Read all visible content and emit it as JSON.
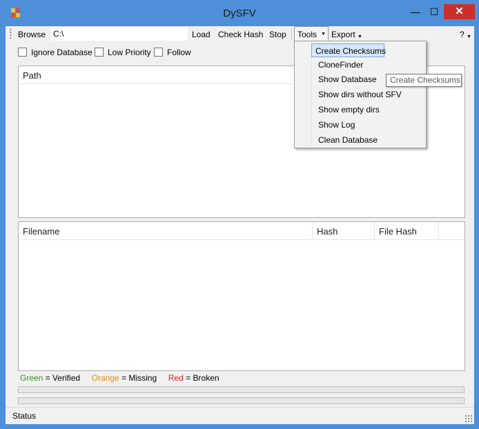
{
  "window": {
    "title": "DySFV",
    "minimize": "—",
    "maximize": "☐",
    "close": "✕"
  },
  "toolbar": {
    "browse": "Browse",
    "path_value": "C:\\",
    "load": "Load",
    "check_hash": "Check Hash",
    "stop": "Stop",
    "tools": "Tools",
    "export": "Export",
    "help": "?"
  },
  "options": {
    "ignore_database": "Ignore Database",
    "low_priority": "Low Priority",
    "follow": "Follow"
  },
  "path_list": {
    "columns": [
      "Path"
    ]
  },
  "file_list": {
    "columns": [
      "Filename",
      "Hash",
      "File Hash"
    ]
  },
  "legend": {
    "green_word": "Green",
    "green_text": " = Verified",
    "orange_word": "Orange",
    "orange_text": " = Missing",
    "red_word": "Red",
    "red_text": " = Broken",
    "colors": {
      "green": "#3c8f1d",
      "orange": "#e88a0e",
      "red": "#d81e1e"
    }
  },
  "tools_menu": {
    "items": [
      "Create Checksums",
      "CloneFinder",
      "Show Database",
      "Show dirs without SFV",
      "Show empty dirs",
      "Show Log",
      "Clean Database"
    ],
    "highlighted": "Create Checksums"
  },
  "tooltip": "Create Checksums",
  "status": "Status"
}
